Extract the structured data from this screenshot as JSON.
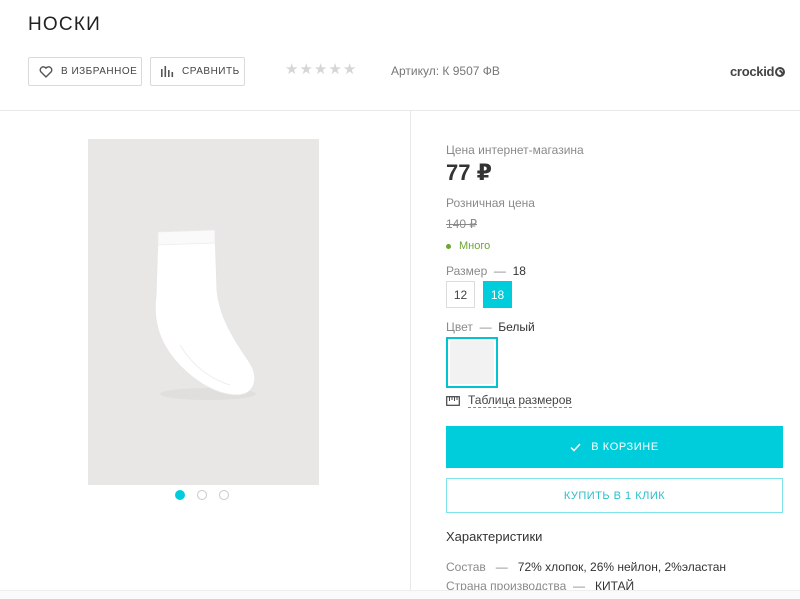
{
  "product": {
    "title": "НОСКИ",
    "sku": "Артикул: К 9507 ФВ",
    "brand": "crockid",
    "rating_stars": 5,
    "rating_filled": 0
  },
  "actions": {
    "favorite_label": "В ИЗБРАННОЕ",
    "compare_label": "СРАВНИТЬ",
    "cart_label": "В КОРЗИНЕ",
    "one_click_label": "КУПИТЬ В 1 КЛИК",
    "size_table_label": "Таблица размеров"
  },
  "gallery": {
    "dots": [
      true,
      false,
      false
    ]
  },
  "pricing": {
    "online_label": "Цена интернет-магазина",
    "online_price": "77 ₽",
    "retail_label": "Розничная цена",
    "retail_price": "140 ₽",
    "stock": "Много"
  },
  "size": {
    "label": "Размер",
    "dash": "—",
    "selected": "18",
    "options": [
      "12",
      "18"
    ]
  },
  "color": {
    "label": "Цвет",
    "dash": "—",
    "selected": "Белый",
    "swatch_hex": "#f2f2f2"
  },
  "characteristics": {
    "title": "Характеристики",
    "rows": [
      {
        "label": "Состав",
        "dash": "—",
        "value": "72% хлопок, 26% нейлон, 2%эластан"
      },
      {
        "label": "Страна производства",
        "dash": "—",
        "value": "КИТАЙ"
      }
    ]
  },
  "colors": {
    "accent": "#00cddb",
    "stock_green": "#6ca531"
  }
}
